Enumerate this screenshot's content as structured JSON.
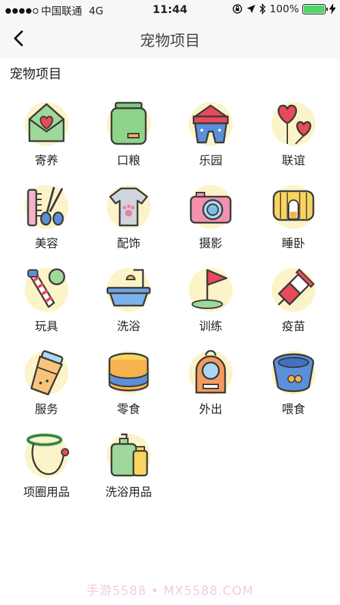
{
  "status_bar": {
    "carrier": "中国联通",
    "network": "4G",
    "time": "11:44",
    "battery": "100%"
  },
  "nav": {
    "title": "宠物项目"
  },
  "section_title": "宠物项目",
  "items": [
    {
      "label": "寄养",
      "icon": "house-heart-icon"
    },
    {
      "label": "口粮",
      "icon": "food-bag-icon"
    },
    {
      "label": "乐园",
      "icon": "carousel-icon"
    },
    {
      "label": "联谊",
      "icon": "heart-balloons-icon"
    },
    {
      "label": "美容",
      "icon": "comb-scissors-icon"
    },
    {
      "label": "配饰",
      "icon": "paw-shirt-icon"
    },
    {
      "label": "摄影",
      "icon": "camera-icon"
    },
    {
      "label": "睡卧",
      "icon": "pet-bed-icon"
    },
    {
      "label": "玩具",
      "icon": "bone-ball-icon"
    },
    {
      "label": "洗浴",
      "icon": "bathtub-icon"
    },
    {
      "label": "训练",
      "icon": "training-flag-icon"
    },
    {
      "label": "疫苗",
      "icon": "syringe-icon"
    },
    {
      "label": "服务",
      "icon": "drink-cup-icon"
    },
    {
      "label": "零食",
      "icon": "snack-can-icon"
    },
    {
      "label": "外出",
      "icon": "pet-carrier-icon"
    },
    {
      "label": "喂食",
      "icon": "food-bowl-icon"
    },
    {
      "label": "项圈用品",
      "icon": "collar-leash-icon"
    },
    {
      "label": "洗浴用品",
      "icon": "shampoo-bottles-icon"
    }
  ],
  "watermark": "手游5588 • MX5588.COM"
}
